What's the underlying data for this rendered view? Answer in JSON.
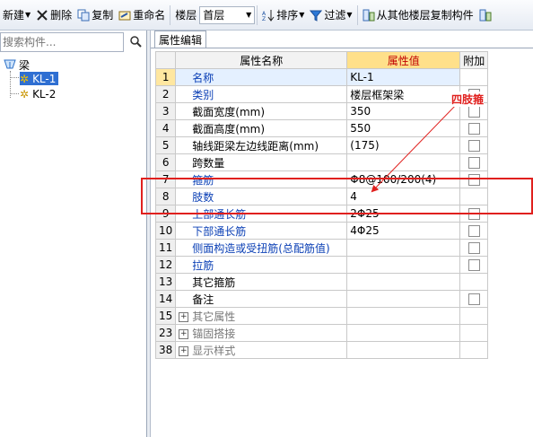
{
  "toolbar": {
    "new_label": "新建",
    "delete_label": "删除",
    "copy_label": "复制",
    "rename_label": "重命名",
    "floor_label": "楼层",
    "floor_value": "首层",
    "sort_label": "排序",
    "filter_label": "过滤",
    "copy_from_floor_label": "从其他楼层复制构件"
  },
  "left_panel": {
    "search_placeholder": "搜索构件...",
    "tree": {
      "root_label": "梁",
      "items": [
        {
          "label": "KL-1",
          "selected": true
        },
        {
          "label": "KL-2",
          "selected": false
        }
      ]
    }
  },
  "right_panel": {
    "tab_label": "属性编辑",
    "columns": {
      "name": "属性名称",
      "value": "属性值",
      "extra": "附加"
    },
    "rows": [
      {
        "index": "1",
        "name": "名称",
        "value": "KL-1",
        "checkbox": false,
        "style": "blue"
      },
      {
        "index": "2",
        "name": "类别",
        "value": "楼层框架梁",
        "checkbox": true,
        "style": "blue"
      },
      {
        "index": "3",
        "name": "截面宽度(mm)",
        "value": "350",
        "checkbox": true,
        "style": "normal"
      },
      {
        "index": "4",
        "name": "截面高度(mm)",
        "value": "550",
        "checkbox": true,
        "style": "normal"
      },
      {
        "index": "5",
        "name": "轴线距梁左边线距离(mm)",
        "value": "(175)",
        "checkbox": true,
        "style": "normal"
      },
      {
        "index": "6",
        "name": "跨数量",
        "value": "",
        "checkbox": true,
        "style": "normal"
      },
      {
        "index": "7",
        "name": "箍筋",
        "value": "Φ8@100/200(4)",
        "checkbox": true,
        "style": "blue"
      },
      {
        "index": "8",
        "name": "肢数",
        "value": "4",
        "checkbox": false,
        "style": "blue"
      },
      {
        "index": "9",
        "name": "上部通长筋",
        "value": "2Φ25",
        "checkbox": true,
        "style": "blue"
      },
      {
        "index": "10",
        "name": "下部通长筋",
        "value": "4Φ25",
        "checkbox": true,
        "style": "blue"
      },
      {
        "index": "11",
        "name": "侧面构造或受扭筋(总配筋值)",
        "value": "",
        "checkbox": true,
        "style": "blue"
      },
      {
        "index": "12",
        "name": "拉筋",
        "value": "",
        "checkbox": true,
        "style": "blue"
      },
      {
        "index": "13",
        "name": "其它箍筋",
        "value": "",
        "checkbox": false,
        "style": "normal"
      },
      {
        "index": "14",
        "name": "备注",
        "value": "",
        "checkbox": true,
        "style": "normal"
      },
      {
        "index": "15",
        "name": "其它属性",
        "value": "",
        "checkbox": false,
        "style": "group"
      },
      {
        "index": "23",
        "name": "锚固搭接",
        "value": "",
        "checkbox": false,
        "style": "group"
      },
      {
        "index": "38",
        "name": "显示样式",
        "value": "",
        "checkbox": false,
        "style": "group"
      }
    ]
  },
  "annotation": {
    "text": "四肢箍",
    "color": "#e0201e"
  },
  "colors": {
    "selection": "#2f6fd2",
    "header_value_bg": "#ffe08a",
    "blue_text": "#0a3fb5"
  }
}
